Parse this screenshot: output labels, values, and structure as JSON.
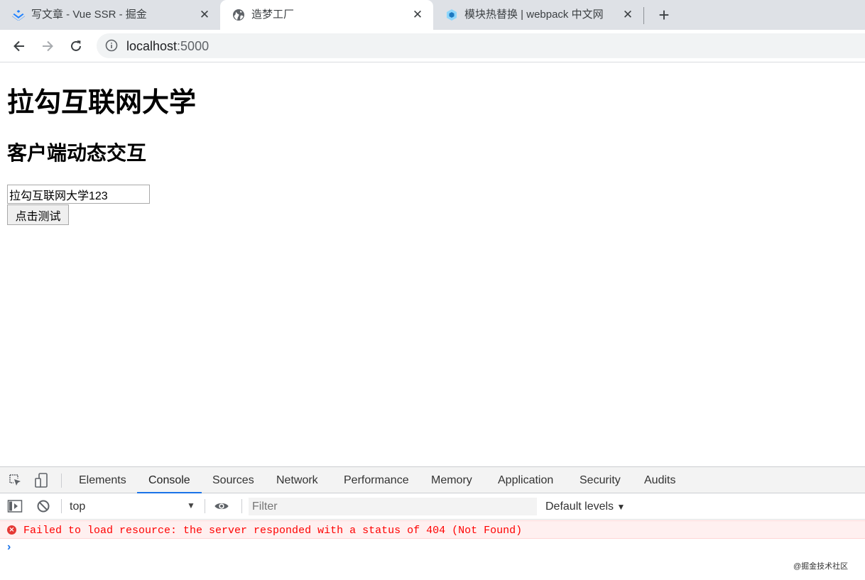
{
  "browser": {
    "tabs": [
      {
        "title": "写文章 - Vue SSR - 掘金",
        "icon": "juejin-logo-icon",
        "active": false
      },
      {
        "title": "造梦工厂",
        "icon": "globe-icon",
        "active": true
      },
      {
        "title": "模块热替换 | webpack 中文网",
        "icon": "webpack-cube-icon",
        "active": false
      }
    ],
    "close_glyph": "✕",
    "new_tab_glyph": "+",
    "address": {
      "host": "localhost",
      "port": ":5000"
    }
  },
  "page": {
    "h1": "拉勾互联网大学",
    "h2": "客户端动态交互",
    "input_value": "拉勾互联网大学123",
    "button_label": "点击测试"
  },
  "devtools": {
    "tabs": [
      "Elements",
      "Console",
      "Sources",
      "Network",
      "Performance",
      "Memory",
      "Application",
      "Security",
      "Audits"
    ],
    "active_tab": "Console",
    "context": "top",
    "filter_placeholder": "Filter",
    "levels": "Default levels",
    "error_message": "Failed to load resource: the server responded with a status of 404 (Not Found)",
    "prompt_glyph": "›"
  },
  "watermark": "@掘金技术社区",
  "colors": {
    "tab_strip": "#dee1e6",
    "accent": "#1a73e8",
    "error_text": "#ff0000",
    "error_bg": "#fff0f0"
  }
}
